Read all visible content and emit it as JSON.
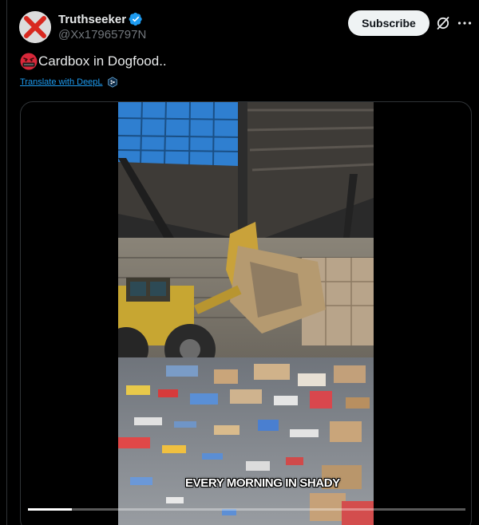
{
  "user": {
    "display_name": "Truthseeker",
    "handle": "@Xx17965797N",
    "verified": true
  },
  "actions": {
    "subscribe_label": "Subscribe"
  },
  "icons": {
    "avatar": "red-x-avatar-icon",
    "verified": "verified-badge-icon",
    "grok": "grok-icon",
    "more": "more-options-icon",
    "emoji": "angry-face-emoji-icon",
    "deepl": "deepl-logo-icon"
  },
  "tweet": {
    "text": "Cardbox in Dogfood..",
    "translate_label": "Translate with DeepL"
  },
  "media": {
    "caption": "EVERY MORNING IN SHADY",
    "progress": 0.1
  },
  "colors": {
    "accent": "#1d9bf0",
    "background": "#000000",
    "verified": "#1d9bf0"
  }
}
